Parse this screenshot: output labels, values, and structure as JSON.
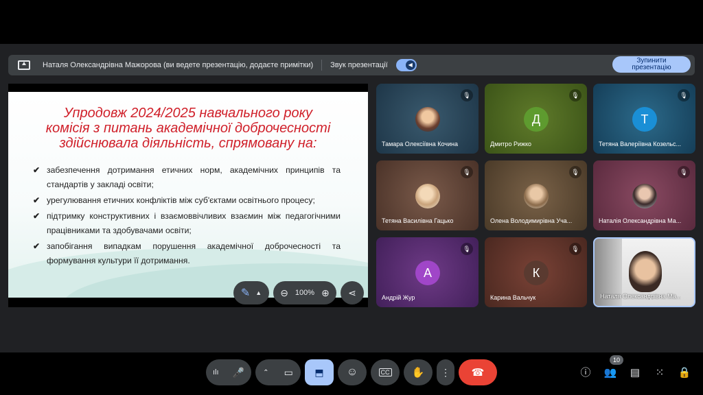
{
  "presenting_bar": {
    "text": "Наталя Олександрівна Мажорова (ви ведете презентацію, додаєте примітки)",
    "audio_label": "Звук презентації",
    "stop_line1": "Зупинити",
    "stop_line2": "презентацію"
  },
  "slide": {
    "title_lines": [
      "Упродовж 2024/2025 навчального року",
      "комісія з питань академічної доброчесності",
      "здійснювала діяльність, спрямовану на:"
    ],
    "bullets": [
      "забезпечення дотримання етичних норм, академічних принципів та стандартів у закладі освіти;",
      "урегулювання етичних конфліктів між суб'єктами освітнього процесу;",
      "підтримку конструктивних і взаємоввічливих взаємин між педагогічними працівниками та здобувачами освіти;",
      "запобігання випадкам порушення академічної доброчесності та формування культури її дотримання."
    ],
    "zoom": "100%"
  },
  "participants": [
    {
      "name": "Тамара Олексіївна Кочина",
      "initial": ""
    },
    {
      "name": "Дмитро Рижко",
      "initial": "Д"
    },
    {
      "name": "Тетяна Валеріївна Козельс...",
      "initial": "Т"
    },
    {
      "name": "Тетяна Василівна Гацько",
      "initial": ""
    },
    {
      "name": "Олена Володимирівна Уча...",
      "initial": ""
    },
    {
      "name": "Наталія Олександрівна Ма...",
      "initial": ""
    },
    {
      "name": "Андрій Жур",
      "initial": "А"
    },
    {
      "name": "Карина Вальчук",
      "initial": "К"
    },
    {
      "name": "Наталя Олександрівна Ма...",
      "initial": ""
    }
  ],
  "participant_count": "10",
  "colors": {
    "end_call": "#ea4335",
    "present_active": "#a8c7fa",
    "slide_title": "#d0202a"
  }
}
